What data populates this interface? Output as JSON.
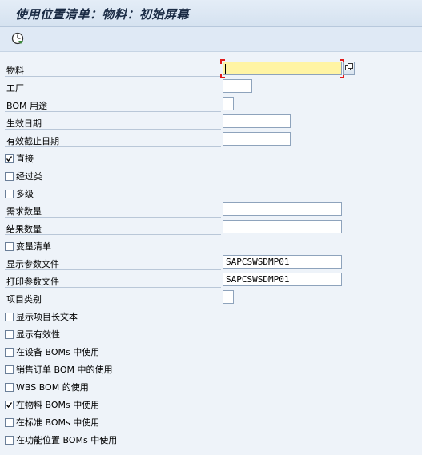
{
  "title": "使用位置清单：物料：初始屏幕",
  "toolbar": {
    "execute_icon": "execute-clock-icon"
  },
  "fields": {
    "material": {
      "label": "物料",
      "value": ""
    },
    "plant": {
      "label": "工厂",
      "value": ""
    },
    "bom_usage": {
      "label": "BOM 用途",
      "value": ""
    },
    "valid_from": {
      "label": "生效日期",
      "value": ""
    },
    "valid_to": {
      "label": "有效截止日期",
      "value": ""
    },
    "direct": {
      "label": "直接",
      "checked": true
    },
    "via_class": {
      "label": "经过类",
      "checked": false
    },
    "multilevel": {
      "label": "多级",
      "checked": false
    },
    "req_qty": {
      "label": "需求数量",
      "value": ""
    },
    "result_qty": {
      "label": "结果数量",
      "value": ""
    },
    "variant": {
      "label": "变量清单",
      "checked": false
    },
    "display_profile": {
      "label": "显示参数文件",
      "value": "SAPCSWSDMP01"
    },
    "print_profile": {
      "label": "打印参数文件",
      "value": "SAPCSWSDMP01"
    },
    "item_cat": {
      "label": "项目类别",
      "value": ""
    },
    "long_text": {
      "label": "显示项目长文本",
      "checked": false
    },
    "show_valid": {
      "label": "显示有效性",
      "checked": false
    },
    "equip_bom": {
      "label": "在设备 BOMs 中使用",
      "checked": false
    },
    "sales_bom": {
      "label": "销售订单 BOM 中的使用",
      "checked": false
    },
    "wbs_bom": {
      "label": "WBS BOM 的使用",
      "checked": false
    },
    "mat_bom": {
      "label": "在物料 BOMs 中使用",
      "checked": true
    },
    "std_bom": {
      "label": "在标准 BOMs 中使用",
      "checked": false
    },
    "fl_bom": {
      "label": "在功能位置 BOMs 中使用",
      "checked": false
    }
  },
  "colors": {
    "background": "#dfe9f5",
    "required_field": "#fff4a4",
    "focus_corner": "#e21b1b"
  }
}
